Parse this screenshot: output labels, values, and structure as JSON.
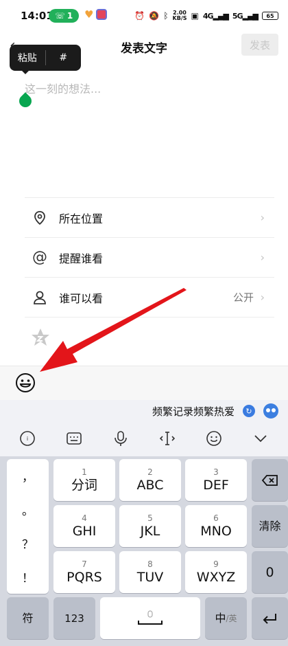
{
  "status_bar": {
    "time": "14:01",
    "call_count": "1",
    "net_speed_value": "2.00",
    "net_speed_unit": "KB/S",
    "signal1": "4G",
    "signal2": "5G",
    "battery": "65"
  },
  "header": {
    "title": "发表文字",
    "publish_label": "发表"
  },
  "paste_popup": {
    "paste_label": "粘贴",
    "hash_label": "#"
  },
  "editor": {
    "placeholder": "这一刻的想法..."
  },
  "options": [
    {
      "label": "所在位置",
      "icon": "location-pin-icon"
    },
    {
      "label": "提醒谁看",
      "icon": "at-icon"
    },
    {
      "label": "谁可以看",
      "icon": "person-icon",
      "value": "公开"
    }
  ],
  "keyboard": {
    "suggestion": "频繁记录频繁热爱",
    "punctuation": [
      "，",
      "。",
      "？",
      "！"
    ],
    "rows": [
      [
        {
          "num": "1",
          "main": "分词"
        },
        {
          "num": "2",
          "main": "ABC"
        },
        {
          "num": "3",
          "main": "DEF"
        }
      ],
      [
        {
          "num": "4",
          "main": "GHI"
        },
        {
          "num": "5",
          "main": "JKL"
        },
        {
          "num": "6",
          "main": "MNO"
        }
      ],
      [
        {
          "num": "7",
          "main": "PQRS"
        },
        {
          "num": "8",
          "main": "TUV"
        },
        {
          "num": "9",
          "main": "WXYZ"
        }
      ]
    ],
    "clear_label": "清除",
    "zero_label": "0",
    "symbol_label": "符",
    "num_label": "123",
    "lang_main": "中",
    "lang_sub": "/英"
  },
  "colors": {
    "accent_green": "#08a650",
    "arrow_red": "#e3151a",
    "publish_disabled_bg": "#ededed"
  }
}
